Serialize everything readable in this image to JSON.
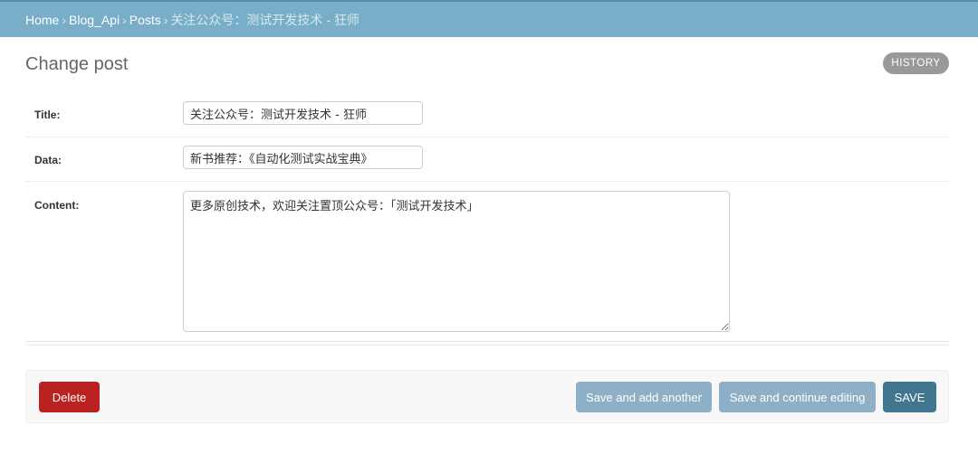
{
  "breadcrumbs": {
    "home": "Home",
    "app": "Blog_Api",
    "model": "Posts",
    "current": "关注公众号：测试开发技术 - 狂师",
    "separator": "›"
  },
  "page": {
    "title": "Change post",
    "history_label": "HISTORY"
  },
  "form": {
    "title_label": "Title:",
    "title_value": "关注公众号：测试开发技术 - 狂师",
    "data_label": "Data:",
    "data_value": "新书推荐：《自动化测试实战宝典》",
    "content_label": "Content:",
    "content_value": "更多原创技术，欢迎关注置顶公众号：「测试开发技术」"
  },
  "submit_row": {
    "delete_label": "Delete",
    "save_add_another_label": "Save and add another",
    "save_continue_label": "Save and continue editing",
    "save_label": "SAVE"
  },
  "colors": {
    "header_bg": "#79aec8",
    "delete_bg": "#ba2121",
    "secondary_btn_bg": "#8eb0c6",
    "save_bg": "#417690",
    "history_bg": "#999999"
  }
}
